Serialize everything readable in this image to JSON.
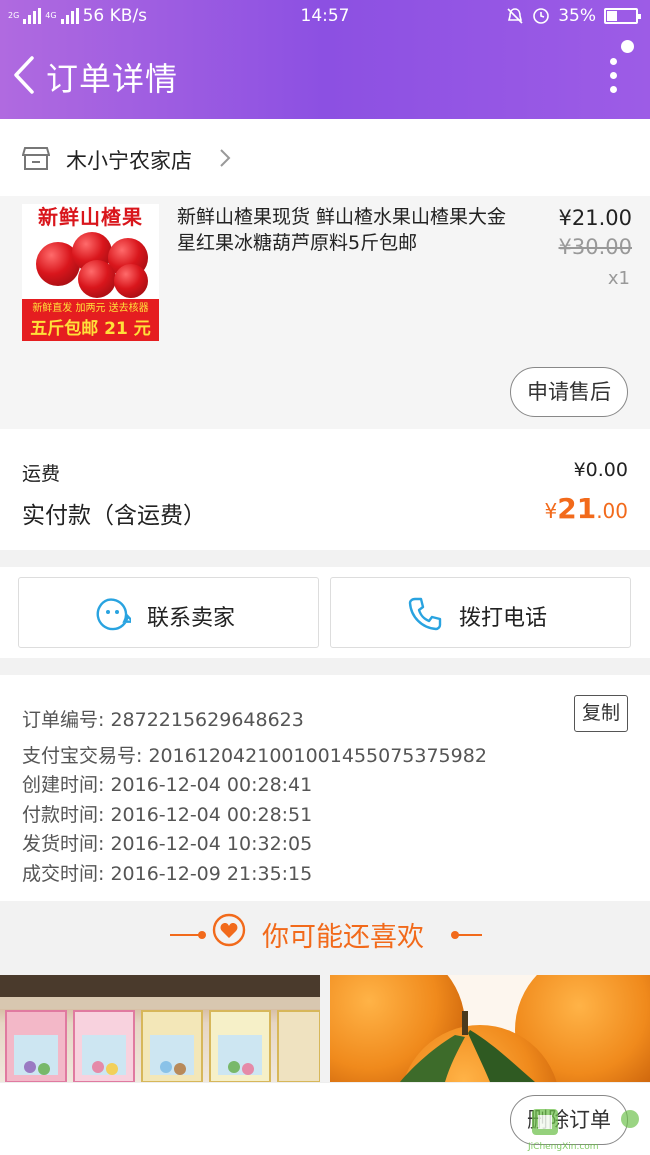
{
  "status_bar": {
    "net1": "2G",
    "net2": "4G",
    "speed": "56 KB/s",
    "time": "14:57",
    "battery": "35%",
    "battery_level": 0.35
  },
  "header": {
    "title": "订单详情"
  },
  "store": {
    "name": "木小宁农家店"
  },
  "product": {
    "thumb_banner": "新鲜山楂果",
    "thumb_line1": "新鲜直发  加两元  送去核器",
    "thumb_line2": "五斤包邮 21 元",
    "name": "新鲜山楂果现货 鲜山楂水果山楂果大金星红果冰糖葫芦原料5斤包邮",
    "price": "¥21.00",
    "original_price": "¥30.00",
    "quantity": "x1",
    "after_sale_label": "申请售后"
  },
  "cost": {
    "shipping_label": "运费",
    "shipping_value": "¥0.00",
    "paid_label": "实付款（含运费）",
    "paid_currency": "¥",
    "paid_int": "21",
    "paid_dec": ".00"
  },
  "contact": {
    "seller_label": "联系卖家",
    "call_label": "拨打电话"
  },
  "order_info": {
    "order_no": "订单编号: 2872215629648623",
    "copy_label": "复制",
    "alipay_no": "支付宝交易号: 2016120421001001455075375982",
    "created": "创建时间: 2016-12-04 00:28:41",
    "paid": "付款时间: 2016-12-04 00:28:51",
    "shipped": "发货时间: 2016-12-04 10:32:05",
    "completed": "成交时间: 2016-12-09 21:35:15"
  },
  "recommend": {
    "title": "你可能还喜欢"
  },
  "bottom": {
    "delete_label": "删除订单"
  },
  "colors": {
    "accent": "#f26a1b",
    "header_purple": "#8c50e2"
  }
}
